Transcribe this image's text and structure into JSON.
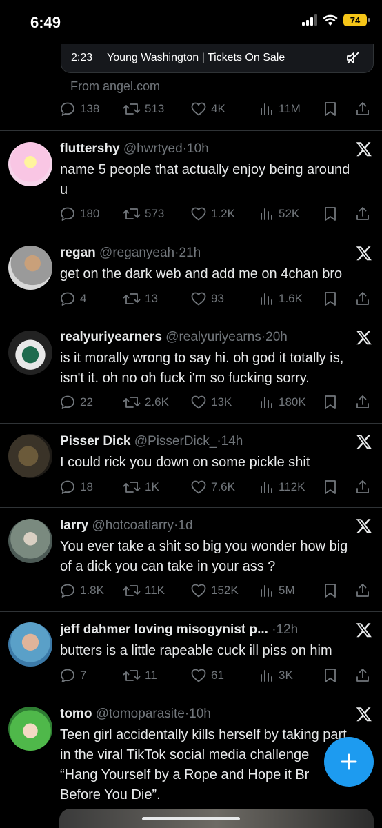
{
  "status": {
    "time": "6:49",
    "battery": "74"
  },
  "top_post": {
    "video_time": "2:23",
    "video_title": "Young Washington | Tickets On Sale",
    "from_source": "From angel.com",
    "replies": "138",
    "retweets": "513",
    "likes": "4K",
    "views": "11M"
  },
  "tweets": [
    {
      "name": "fluttershy",
      "handle": "@hwrtyed",
      "dot": "·",
      "time": "10h",
      "lines": [
        "name 5 people that actually enjoy being around",
        "u"
      ],
      "replies": "180",
      "retweets": "573",
      "likes": "1.2K",
      "views": "52K"
    },
    {
      "name": "regan",
      "handle": "@reganyeah",
      "dot": "·",
      "time": "21h",
      "lines": [
        "get on the dark web and add me on 4chan bro"
      ],
      "replies": "4",
      "retweets": "13",
      "likes": "93",
      "views": "1.6K"
    },
    {
      "name": "realyuriyearners",
      "handle": "@realyuriyearns",
      "dot": "·",
      "time": "20h",
      "lines": [
        "is it morally wrong to say hi. oh god it totally is,",
        "isn't it. oh no oh fuck i'm so fucking sorry."
      ],
      "replies": "22",
      "retweets": "2.6K",
      "likes": "13K",
      "views": "180K"
    },
    {
      "name": "Pisser Dick",
      "handle": "@PisserDick_",
      "dot": "·",
      "time": "14h",
      "lines": [
        "I could rick you down on some pickle shit"
      ],
      "replies": "18",
      "retweets": "1K",
      "likes": "7.6K",
      "views": "112K"
    },
    {
      "name": "larry",
      "handle": "@hotcoatlarry",
      "dot": "·",
      "time": "1d",
      "lines": [
        "You ever take a shit so big you wonder how big",
        "of a dick you can take in your ass ?"
      ],
      "replies": "1.8K",
      "retweets": "11K",
      "likes": "152K",
      "views": "5M"
    },
    {
      "name": "jeff dahmer loving misogynist p...",
      "handle": "",
      "dot": "·",
      "time": "12h",
      "lines": [
        "butters is a little rapeable cuck ill piss on him"
      ],
      "replies": "7",
      "retweets": "11",
      "likes": "61",
      "views": "3K"
    },
    {
      "name": "tomo",
      "handle": "@tomoparasite",
      "dot": "·",
      "time": "10h",
      "lines": [
        "Teen girl accidentally kills herself by taking part",
        "in the viral TikTok social media challenge",
        "“Hang Yourself by a Rope and Hope it Br",
        "Before You Die”."
      ]
    }
  ],
  "colors": {
    "accent": "#1d9bf0",
    "muted": "#71767b",
    "divider": "#2f3336",
    "battery": "#f5c518"
  }
}
